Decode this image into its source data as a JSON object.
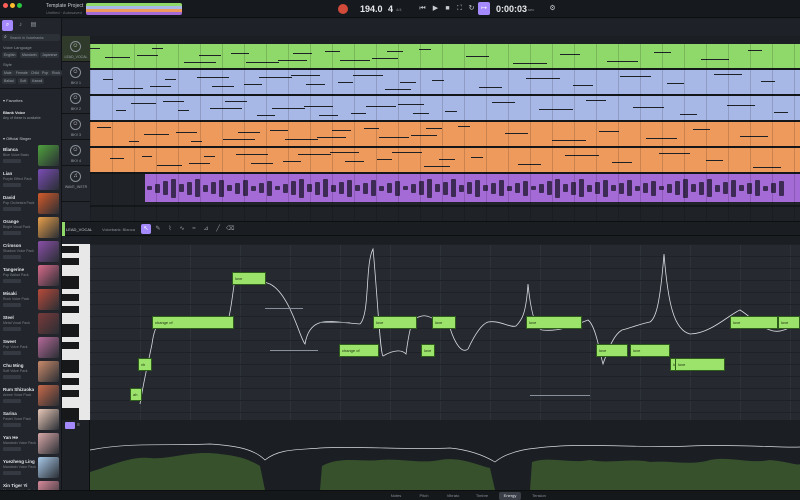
{
  "titlebar": {
    "project_title": "Template Project",
    "project_subtitle": "Untitled · Autosaved",
    "tempo": "194.0",
    "time_signature": "4",
    "tempo_unit": "bpm",
    "signature_unit": "4/4",
    "time_display": "0:00:03",
    "time_unit": "sec",
    "icons": [
      "metronome-icon",
      "skip-back-icon",
      "play-icon",
      "stop-icon",
      "loop-icon",
      "punch-icon",
      "cursor-icon",
      "settings-icon"
    ]
  },
  "left_panel": {
    "tabs": [
      "singers-tab",
      "tracks-tab",
      "files-tab"
    ],
    "search_placeholder": "Search in Voicebanks",
    "filter_label": "Voice Language",
    "language_chips": [
      "English",
      "Mandarin",
      "Japanese"
    ],
    "style_label": "Style",
    "style_chips": [
      "Male",
      "Female",
      "Child",
      "Pop",
      "Rock"
    ],
    "extra_chips": [
      "Ballad",
      "Soft",
      "Kawaii"
    ],
    "favorites_label": "Favorites",
    "blank_voice": {
      "name": "Blank Voice",
      "desc": "Any of these is available"
    },
    "official_label": "Official Singer",
    "singers": [
      {
        "name": "Blanca",
        "desc": "Blue Voice Basic",
        "color": "#4fa13d"
      },
      {
        "name": "Lian",
        "desc": "Purple Effect Pack",
        "color": "#7a4db5"
      },
      {
        "name": "David",
        "desc": "Pop Orchestra Pack",
        "color": "#d45a2a"
      },
      {
        "name": "Orange",
        "desc": "Bright Vocal Pack",
        "color": "#e8a04a"
      },
      {
        "name": "Crimson",
        "desc": "Shadow Voice Pack",
        "color": "#8a4fa8"
      },
      {
        "name": "Tangerine",
        "desc": "Pop Ballad Pack",
        "color": "#d86a8a"
      },
      {
        "name": "Misaki",
        "desc": "Rock Voice Pack",
        "color": "#b84a3a"
      },
      {
        "name": "Steel",
        "desc": "Metal Vocal Pack",
        "color": "#7a3a3a"
      },
      {
        "name": "Sweet",
        "desc": "Pop Voice Pack",
        "color": "#b56a9a"
      },
      {
        "name": "Chu Ming",
        "desc": "Soft Voice Pack",
        "color": "#c98a6a"
      },
      {
        "name": "Rum Shizuoka",
        "desc": "Anime Voice Pack",
        "color": "#c96a4a"
      },
      {
        "name": "Sarina",
        "desc": "Pastel Voice Pack",
        "color": "#e8c8b8"
      },
      {
        "name": "Yan He",
        "desc": "Mandarin Voice Pack",
        "color": "#d8a8a8"
      },
      {
        "name": "Yuezheng Ling",
        "desc": "Mandarin Voice Pack",
        "color": "#a8c8e8"
      },
      {
        "name": "Xin Tiger Yi",
        "desc": "Mandarin Voice Pack",
        "color": "#d88a9a"
      }
    ]
  },
  "tracks": [
    {
      "label": "LEAD_VOCAL",
      "color": "#8fd86a",
      "selected": true
    },
    {
      "label": "BKV 1",
      "color": "#a8b8e6"
    },
    {
      "label": "BKV 2",
      "color": "#a8b8e6"
    },
    {
      "label": "BKV 3",
      "color": "#ee9a5c"
    },
    {
      "label": "BKV 4",
      "color": "#ee9a5c"
    },
    {
      "label": "WAVE_INSTR",
      "color": "#a46ad6"
    }
  ],
  "editor": {
    "track_name": "LEAD_VOCAL",
    "voice_label": "Voicebank: Blanca",
    "tools": [
      "select-tool",
      "pencil-tool",
      "knife-tool",
      "pitch-tool",
      "vibrato-tool",
      "ruler-tool",
      "line-tool",
      "eraser-tool"
    ],
    "lyrics": [
      "ah",
      "vh",
      "change of",
      "change of",
      "love",
      "love",
      "love",
      "love",
      "love",
      "love",
      "love",
      "love",
      "love",
      "love",
      "love",
      "love"
    ]
  },
  "bottom_tabs": [
    "Notes",
    "Pitch",
    "Vibrato",
    "Timbre",
    "Energy",
    "Tension"
  ],
  "colors": {
    "accent": "#8fd86a",
    "purple_accent": "#a58aff"
  }
}
